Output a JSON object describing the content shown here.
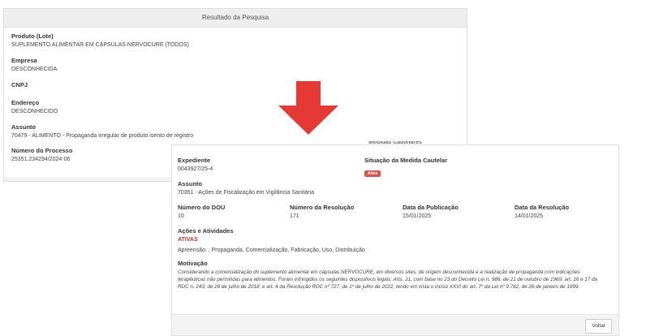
{
  "result_panel": {
    "header": "Resultado da Pesquisa",
    "fields": [
      {
        "label": "Produto (Lote)",
        "value": "SUPLEMENTO ALIMENTAR EM CÁPSULAS NERVOCURE (TODOS)"
      },
      {
        "label": "Empresa",
        "value": "DESCONHECIDA"
      },
      {
        "label": "CNPJ",
        "value": ""
      },
      {
        "label": "Endereço",
        "value": "DESCONHECIDO"
      },
      {
        "label": "Assunto",
        "value": "70479 - ALIMENTO - Propaganda irregular de produto isento de registro"
      },
      {
        "label": "Número do Processo",
        "value": "25351.234294/2024-06"
      }
    ]
  },
  "arrow": {
    "icon": "arrow-down-icon",
    "color": "#e53935"
  },
  "measure_panel": {
    "cut_title": "Medidas Cautelares",
    "expediente_label": "Expediente",
    "expediente_value": "0043927/25-4",
    "situacao_label": "Situação da Medida Cautelar",
    "situacao_badge": "Ativa",
    "assunto_label": "Assunto",
    "assunto_value": "70351 - Ações de Fiscalização em Vigilância Sanitária",
    "dou_label": "Número do DOU",
    "dou_value": "10",
    "resolucao_label": "Número da Resolução",
    "resolucao_value": "171",
    "publicacao_label": "Data da Publicação",
    "publicacao_value": "15/01/2025",
    "data_resolucao_label": "Data da Resolução",
    "data_resolucao_value": "14/01/2025",
    "acoes_label": "Ações e Atividades",
    "acoes_status": "ATIVAS",
    "acoes_value": "Apreensão: , Propaganda, Comercialização, Fabricação, Uso, Distribuição",
    "motivacao_label": "Motivação",
    "motivacao_value": "Considerando a comercialização do suplemento alimentar em cápsulas NERVOCURE, em diversos sites, de origem desconhecida e a realização de propaganda com indicações terapêuticas não permitidas para alimentos. Foram infringidos os seguintes dispositivos legais: Arts. 21, com base no 23 do Decreto Lei n. 986, de 21 de outubro de 1969; art. 16 e 17 da RDC n. 243, de 26 de julho de 2018; e art. 4 da Resolução RDC nº 727, de 1º de julho de 2022, tendo em vista o inciso XXVI do art. 7º da Lei nº 9.782, de 26 de janeiro de 1999.",
    "voltar_label": "Voltar"
  },
  "colors": {
    "badge": "#d9534f",
    "status": "#c0392b",
    "arrow": "#e53935"
  }
}
